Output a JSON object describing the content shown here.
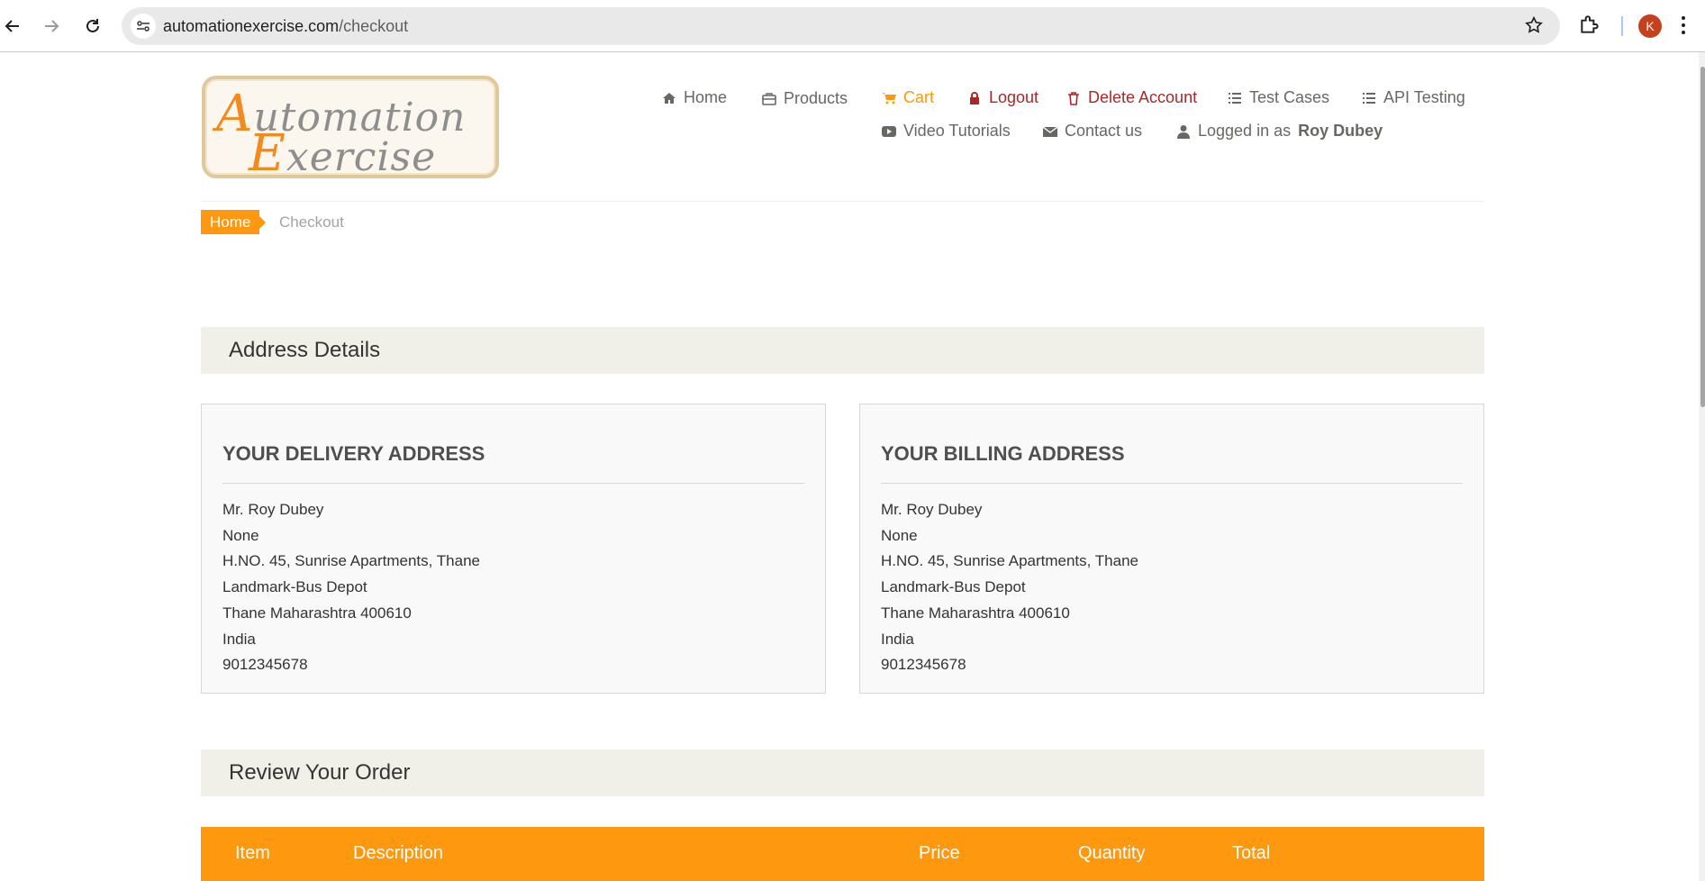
{
  "browser": {
    "url_host": "automationexercise.com",
    "url_path": "/checkout",
    "profile_initial": "K"
  },
  "logo": {
    "line1_cap": "A",
    "line1_rest": "utomation",
    "line2_cap": "E",
    "line2_rest": "xercise"
  },
  "nav": {
    "home": "Home",
    "products": "Products",
    "cart": "Cart",
    "logout": "Logout",
    "delete_account": "Delete Account",
    "test_cases": "Test Cases",
    "api_testing": "API Testing",
    "video_tutorials": "Video Tutorials",
    "contact_us": "Contact us",
    "logged_in_prefix": "Logged in as",
    "logged_in_user": "Roy Dubey"
  },
  "breadcrumb": {
    "home": "Home",
    "current": "Checkout"
  },
  "address_section": {
    "title": "Address Details"
  },
  "delivery": {
    "title": "YOUR DELIVERY ADDRESS",
    "lines": [
      "Mr. Roy Dubey",
      "None",
      "H.NO. 45, Sunrise Apartments, Thane",
      "Landmark-Bus Depot",
      "Thane Maharashtra 400610",
      "India",
      "9012345678"
    ]
  },
  "billing": {
    "title": "YOUR BILLING ADDRESS",
    "lines": [
      "Mr. Roy Dubey",
      "None",
      "H.NO. 45, Sunrise Apartments, Thane",
      "Landmark-Bus Depot",
      "Thane Maharashtra 400610",
      "India",
      "9012345678"
    ]
  },
  "review_section": {
    "title": "Review Your Order"
  },
  "order_table": {
    "columns": [
      "Item",
      "Description",
      "Price",
      "Quantity",
      "Total"
    ]
  },
  "colors": {
    "accent": "#fe980f",
    "danger": "#a82828",
    "section_bg": "#f0f0e9"
  }
}
